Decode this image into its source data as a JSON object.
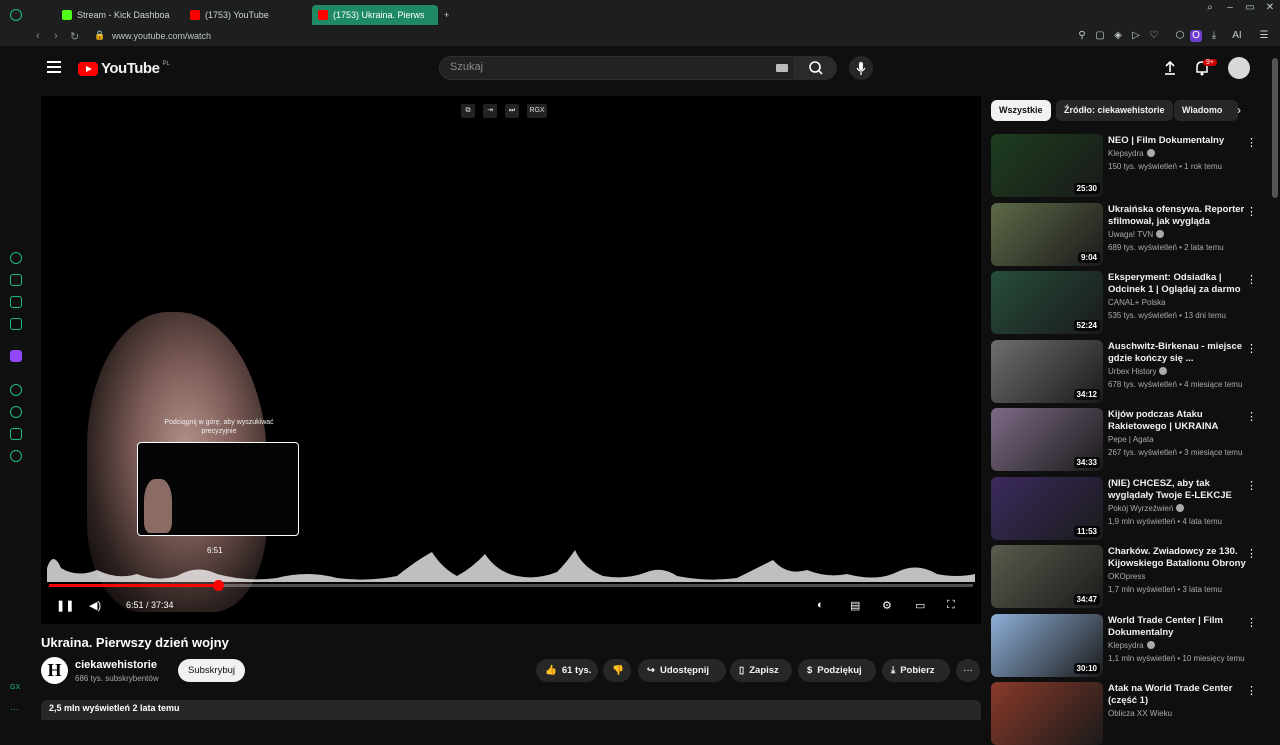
{
  "browser": {
    "tabs": [
      {
        "label": "Stream - Kick Dashboa",
        "color": "#53fc18"
      },
      {
        "label": "(1753) YouTube",
        "color": "#ff0000"
      },
      {
        "label": "(1753) Ukraina. Pierws",
        "color": "#ff0000"
      }
    ],
    "address": "www.youtube.com/watch",
    "ai_label": "AI"
  },
  "masthead": {
    "logo": "YouTube",
    "region": "PL",
    "search_placeholder": "Szukaj",
    "notifications_badge": "9+"
  },
  "player": {
    "hint": "Podciągnij w górę, aby wyszukiwać precyzyjnie",
    "preview_time": "6:51",
    "time_display": "6:51 / 37:34",
    "progress": 0.183,
    "top_button_label": "RGX"
  },
  "video": {
    "title": "Ukraina. Pierwszy dzień wojny",
    "channel": {
      "name": "ciekawehistorie",
      "subscribers": "686 tys. subskrybentów",
      "avatar_letter": "H"
    },
    "subscribe_label": "Subskrybuj",
    "actions": {
      "likes": "61 tys.",
      "share": "Udostępnij",
      "save": "Zapisz",
      "thanks": "Podziękuj",
      "download": "Pobierz"
    },
    "description_meta": "2,5 mln wyświetleń  2 lata temu"
  },
  "chips": [
    "Wszystkie",
    "Źródło: ciekawehistorie",
    "Wiadomo"
  ],
  "recommendations": [
    {
      "title": "NEO | Film Dokumentalny",
      "channel": "Klepsydra",
      "verified": true,
      "meta": "150 tys. wyświetleń • 1 rok temu",
      "duration": "25:30",
      "thumb": "#1d3d1e"
    },
    {
      "title": "Ukraińska ofensywa. Reporter sfilmował, jak wygląda pierws...",
      "channel": "Uwaga! TVN",
      "verified": true,
      "meta": "689 tys. wyświetleń • 2 lata temu",
      "duration": "9:04",
      "thumb": "#5e6a48"
    },
    {
      "title": "Eksperyment: Odsiadka | Odcinek 1 | Oglądaj za darmo",
      "channel": "CANAL+ Polska",
      "verified": false,
      "meta": "535 tys. wyświetleń • 13 dni temu",
      "duration": "52:24",
      "thumb": "#274d3b"
    },
    {
      "title": "Auschwitz-Birkenau - miejsce gdzie kończy się ...",
      "channel": "Urbex History",
      "verified": true,
      "meta": "678 tys. wyświetleń • 4 miesiące temu",
      "duration": "34:12",
      "thumb": "#6d6f6f"
    },
    {
      "title": "Kijów podczas Ataku Rakietowego | UKRAINA",
      "channel": "Pepe | Agata",
      "verified": false,
      "meta": "267 tys. wyświetleń • 3 miesiące temu",
      "duration": "34:33",
      "thumb": "#7d6a86"
    },
    {
      "title": "(NIE) CHCESZ, aby tak wyglądały Twoje E-LEKCJE",
      "channel": "Pokój Wyrzeźwień",
      "verified": true,
      "meta": "1,9 mln wyświetleń • 4 lata temu",
      "duration": "11:53",
      "thumb": "#3b2a5e"
    },
    {
      "title": "Charków. Zwiadowcy ze 130. Kijowskiego Batalionu Obrony ...",
      "channel": "OKOpress",
      "verified": false,
      "meta": "1,7 mln wyświetleń • 3 lata temu",
      "duration": "34:47",
      "thumb": "#5a5c4d"
    },
    {
      "title": "World Trade Center | Film Dokumentalny",
      "channel": "Klepsydra",
      "verified": true,
      "meta": "1,1 mln wyświetleń • 10 miesięcy temu",
      "duration": "30:10",
      "thumb": "#8fb0d8"
    },
    {
      "title": "Atak na World Trade Center (część 1)",
      "channel": "Oblicza XX Wieku",
      "verified": false,
      "meta": "",
      "duration": "",
      "thumb": "#8a3a2a"
    }
  ]
}
